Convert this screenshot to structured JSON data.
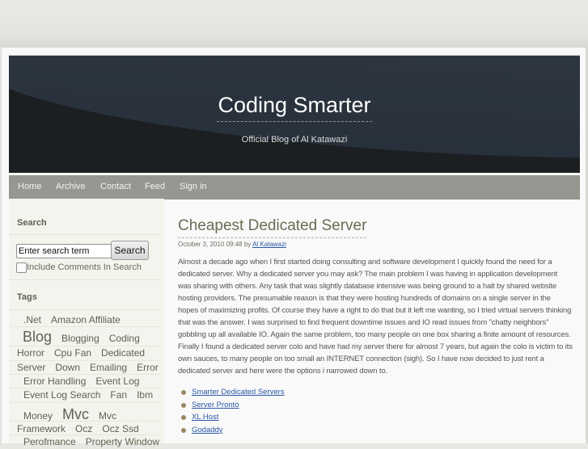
{
  "site": {
    "title": "Coding Smarter",
    "subtitle": "Official Blog of Al Katawazi"
  },
  "nav": {
    "items": [
      {
        "label": "Home"
      },
      {
        "label": "Archive"
      },
      {
        "label": "Contact"
      },
      {
        "label": "Feed"
      },
      {
        "label": "Sign in"
      }
    ]
  },
  "sidebar": {
    "search": {
      "heading": "Search",
      "input_value": "Enter search term",
      "button_label": "Search",
      "checkbox_label": "Include Comments In Search",
      "checkbox_checked": false
    },
    "tags": {
      "heading": "Tags",
      "lines": [
        [
          ".Net",
          "Amazon Affiliate"
        ],
        [
          "Blog",
          "Blogging",
          "Coding"
        ],
        [
          "Horror",
          "Cpu Fan",
          "Dedicated"
        ],
        [
          "Server",
          "Down",
          "Emailing",
          "Error"
        ],
        [
          "Error Handling",
          "Event Log"
        ],
        [
          "Event Log Search",
          "Fan",
          "Ibm"
        ],
        [
          "Money",
          "Mvc",
          "Mvc"
        ],
        [
          "Framework",
          "Ocz",
          "Ocz Ssd"
        ],
        [
          "Perofmance",
          "Property Window"
        ]
      ]
    }
  },
  "post": {
    "title": "Cheapest Dedicated Server",
    "date": "October 3, 2010 09:48",
    "by": "by",
    "author": "Al Katawazi",
    "body": "Almost a decade ago when I first started doing consulting and software development I quickly found the need for a dedicated server. Why a dedicated server you may ask? The main problem I was having in application development was sharing with others. Any task that was slightly database intensive was being ground to a halt by shared website hosting providers. The presumable reason is that they were hosting hundreds of domains on a single server in the hopes of maximizing profits. Of course they have a right to do that but it left me wanting, so I tried virtual servers thinking that was the answer. I was surprised to find frequent downtime issues and IO read issues from \"chatty neighbors\" gobbling up all available IO. Again the same problem, too many people on one box sharing a finite amount of resources. Finally I found a dedicated server colo and have had my server there for almost 7 years, but again the colo is victim to its own sauces, to many people on too small an INTERNET connection (sigh). So I have now decided to just rent a dedicated server and here were the options i narrowed down to.",
    "links": [
      "Smarter Dedicated Servers",
      "Server Pronto",
      "XL Host",
      "Godaddy"
    ]
  }
}
